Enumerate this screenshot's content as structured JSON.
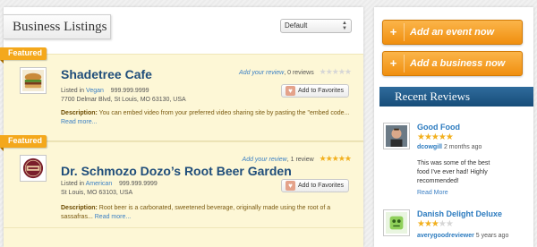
{
  "header": {
    "title": "Business Listings",
    "sort": {
      "selected": "Default"
    }
  },
  "listings": [
    {
      "badge": "Featured",
      "name": "Shadetree Cafe",
      "add_review": "Add your review",
      "review_count": "0 reviews",
      "rating": 0,
      "category_prefix": "Listed in",
      "category": "Vegan",
      "phone": "999.999.9999",
      "address": "7700 Delmar Blvd, St Louis, MO 63130, USA",
      "favorite_label": "Add to Favorites",
      "description_label": "Description:",
      "description": "You can embed video from your preferred video sharing site by pasting the \"embed code...",
      "read_more": "Read more..."
    },
    {
      "badge": "Featured",
      "name": "Dr. Schmozo Dozo’s Root Beer Garden",
      "add_review": "Add your review",
      "review_count": "1 review",
      "rating": 5,
      "category_prefix": "Listed in",
      "category": "American",
      "phone": "999.999.9999",
      "address": "St Louis, MO 63103, USA",
      "favorite_label": "Add to Favorites",
      "description_label": "Description:",
      "description": "Root beer is a carbonated, sweetened beverage, originally made using the root of a sassafras...",
      "read_more": "Read more..."
    }
  ],
  "sidebar": {
    "buttons": [
      {
        "label": "Add an event now",
        "icon": "plus-icon"
      },
      {
        "label": "Add a business now",
        "icon": "plus-icon"
      }
    ],
    "recent_reviews_title": "Recent Reviews",
    "reviews": [
      {
        "title": "Good Food",
        "rating": 5,
        "user": "dcowgill",
        "time": "2 months ago",
        "text": "This was some of the best food I've ever had! Highly recommended!",
        "read_more": "Read More"
      },
      {
        "title": "Danish Delight Deluxe",
        "rating": 3,
        "user": "averygoodreviewer",
        "time": "5 years ago"
      }
    ]
  },
  "colors": {
    "accent_orange": "#f4a81c",
    "link_blue": "#3a7fc4",
    "header_blue": "#1f4d7a",
    "listing_bg": "#fdf7d6"
  }
}
